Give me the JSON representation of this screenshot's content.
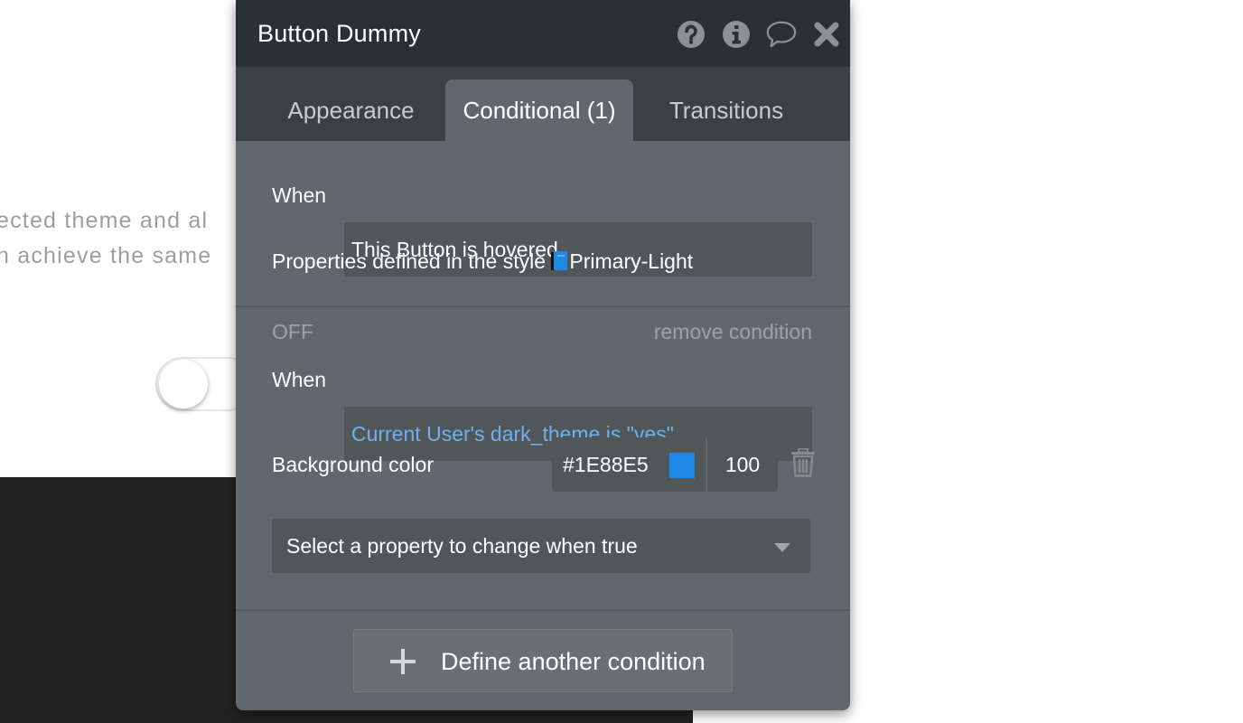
{
  "background": {
    "text_line1": "ected theme and al",
    "text_line2": "n achieve the same",
    "toggle_state": "off"
  },
  "panel": {
    "title": "Button Dummy",
    "header_icons": [
      "help-icon",
      "info-icon",
      "comment-icon",
      "close-icon"
    ],
    "tabs": [
      {
        "label": "Appearance",
        "active": false
      },
      {
        "label": "Conditional (1)",
        "active": true
      },
      {
        "label": "Transitions",
        "active": false
      }
    ],
    "condition1": {
      "when_label": "When",
      "expression": "This Button is hovered",
      "style_prefix": "Properties defined in the style ",
      "style_icon": "book-icon",
      "style_name": "Primary-Light"
    },
    "condition2": {
      "status": "OFF",
      "remove_label": "remove condition",
      "when_label": "When",
      "expression": "Current User's dark_theme is \"yes\"",
      "property_label": "Background color",
      "color_hex": "#1E88E5",
      "swatch_color": "#1E88E5",
      "opacity": "100",
      "property_select_placeholder": "Select a property to change when true"
    },
    "add_condition_label": "Define another condition"
  }
}
